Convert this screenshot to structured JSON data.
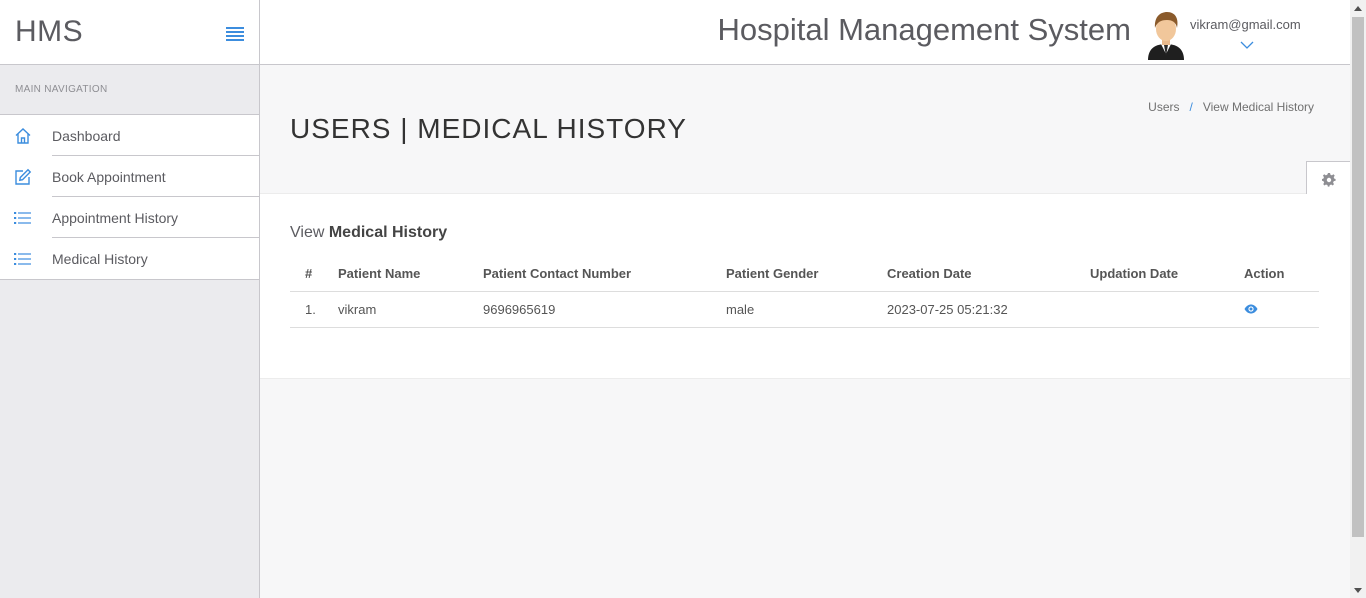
{
  "brand": {
    "name": "HMS"
  },
  "sidebar": {
    "nav_title": "MAIN NAVIGATION",
    "items": [
      {
        "label": "Dashboard",
        "icon": "home-icon"
      },
      {
        "label": "Book Appointment",
        "icon": "edit-icon"
      },
      {
        "label": "Appointment History",
        "icon": "list-icon"
      },
      {
        "label": "Medical History",
        "icon": "list-icon"
      }
    ]
  },
  "header": {
    "title": "Hospital Management System",
    "user_email": "vikram@gmail.com"
  },
  "page": {
    "title": "USERS | MEDICAL HISTORY",
    "breadcrumb": [
      "Users",
      "View Medical History"
    ],
    "breadcrumb_sep": "/"
  },
  "panel": {
    "title_prefix": "View",
    "title_bold": "Medical History",
    "columns": [
      "#",
      "Patient Name",
      "Patient Contact Number",
      "Patient Gender",
      "Creation Date",
      "Updation Date",
      "Action"
    ],
    "rows": [
      {
        "num": "1.",
        "name": "vikram",
        "contact": "9696965619",
        "gender": "male",
        "created": "2023-07-25 05:21:32",
        "updated": "",
        "action_icon": "eye-icon"
      }
    ]
  },
  "colors": {
    "accent": "#3c8dde",
    "text": "#5b5b60",
    "border": "#c8c7cc"
  }
}
